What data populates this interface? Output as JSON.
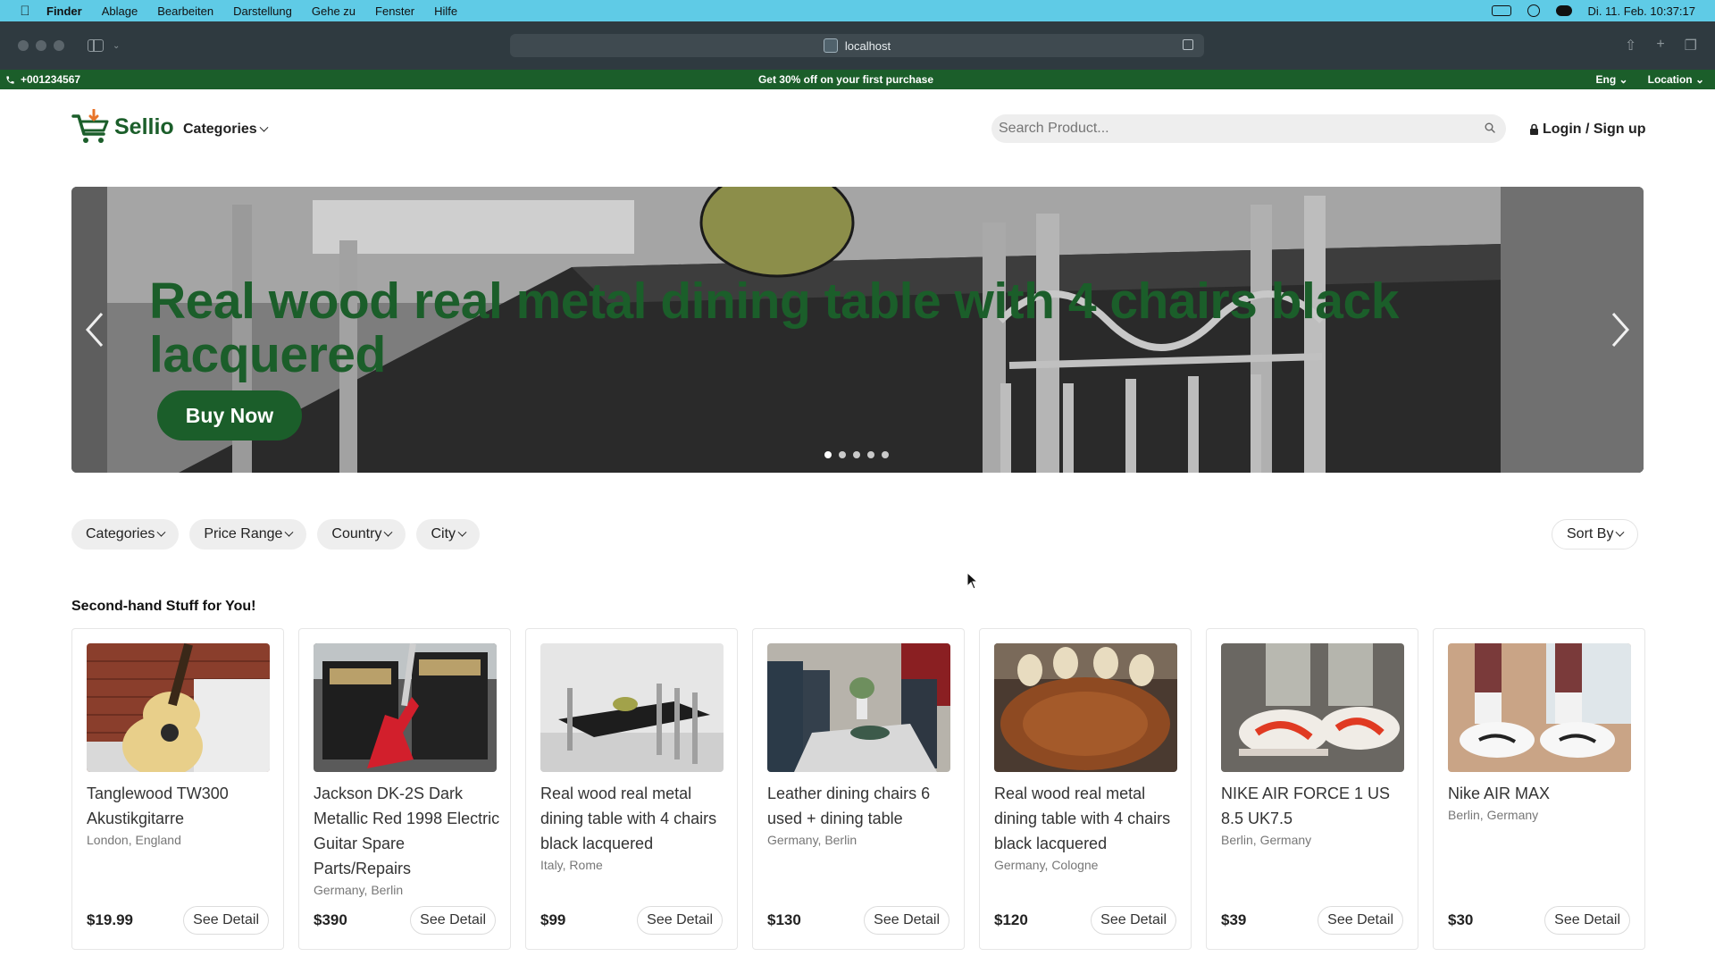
{
  "menubar": {
    "app": "Finder",
    "items": [
      "Ablage",
      "Bearbeiten",
      "Darstellung",
      "Gehe zu",
      "Fenster",
      "Hilfe"
    ],
    "datetime": "Di. 11. Feb. 10:37:17"
  },
  "browser": {
    "url": "localhost"
  },
  "promo": {
    "phone": "+001234567",
    "message": "Get 30% off on your first purchase",
    "language": "Eng",
    "location": "Location"
  },
  "header": {
    "brand": "Sellio",
    "categories": "Categories",
    "search_placeholder": "Search Product...",
    "login": "Login / Sign up"
  },
  "hero": {
    "title": "Real wood real metal dining table with 4 chairs black lacquered",
    "button": "Buy Now",
    "slide_count": 5,
    "active_slide": 1
  },
  "filters": {
    "items": [
      "Categories",
      "Price Range",
      "Country",
      "City"
    ],
    "sort": "Sort By"
  },
  "section_title": "Second-hand Stuff for You!",
  "products": [
    {
      "title": "Tanglewood TW300 Akustikgitarre",
      "location": "London, England",
      "price": "$19.99",
      "button": "See Detail",
      "image": "acoustic-guitar"
    },
    {
      "title": "Jackson DK-2S Dark Metallic Red 1998 Electric Guitar Spare Parts/Repairs",
      "location": "Germany, Berlin",
      "price": "$390",
      "button": "See Detail",
      "image": "electric-guitar"
    },
    {
      "title": "Real wood real metal dining table with 4 chairs black lacquered",
      "location": "Italy, Rome",
      "price": "$99",
      "button": "See Detail",
      "image": "dining-table-black"
    },
    {
      "title": "Leather dining chairs 6 used + dining table",
      "location": "Germany, Berlin",
      "price": "$130",
      "button": "See Detail",
      "image": "leather-chairs"
    },
    {
      "title": "Real wood real metal dining table with 4 chairs black lacquered",
      "location": "Germany, Cologne",
      "price": "$120",
      "button": "See Detail",
      "image": "wooden-table"
    },
    {
      "title": "NIKE AIR FORCE 1 US 8.5 UK7.5",
      "location": "Berlin, Germany",
      "price": "$39",
      "button": "See Detail",
      "image": "red-sneakers"
    },
    {
      "title": "Nike AIR MAX",
      "location": "Berlin, Germany",
      "price": "$30",
      "button": "See Detail",
      "image": "white-sneakers"
    }
  ],
  "colors": {
    "brand_green": "#1b5e2a",
    "menubar": "#5fcbe6",
    "chrome": "#2f3a40"
  }
}
